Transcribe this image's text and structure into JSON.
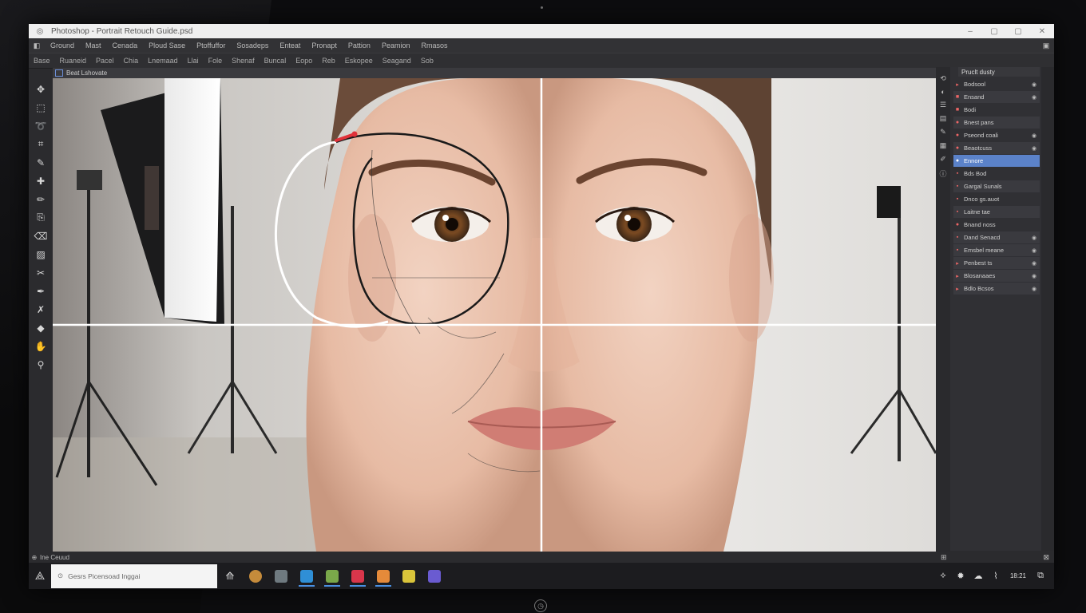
{
  "window": {
    "title": "Photoshop - Portrait Retouch Guide.psd",
    "controls": [
      "–",
      "▢",
      "✕"
    ],
    "close_glyph": "✕"
  },
  "menu": [
    "Ground",
    "Mast",
    "Cenada",
    "Ploud Sase",
    "Ptoffuffor",
    "Sosadeps",
    "Enteat",
    "Pronapt",
    "Pattion",
    "Peamion",
    "Rmasos"
  ],
  "options": [
    "Base",
    "Ruaneid",
    "Pacel",
    "Chia",
    "Lnemaad",
    "Llai",
    "Fole",
    "Shenaf",
    "Buncal",
    "Eopo",
    "Reb",
    "Eskopee",
    "Seagand",
    "Sob"
  ],
  "document_tab": {
    "label": "Beat Lshovate"
  },
  "tools": [
    {
      "name": "move-tool-icon",
      "glyph": "✥"
    },
    {
      "name": "marquee-tool-icon",
      "glyph": "⬚"
    },
    {
      "name": "lasso-tool-icon",
      "glyph": "➰"
    },
    {
      "name": "crop-tool-icon",
      "glyph": "⌗"
    },
    {
      "name": "eyedropper-tool-icon",
      "glyph": "✎"
    },
    {
      "name": "healing-tool-icon",
      "glyph": "✚"
    },
    {
      "name": "brush-tool-icon",
      "glyph": "✏"
    },
    {
      "name": "clone-tool-icon",
      "glyph": "⎘"
    },
    {
      "name": "eraser-tool-icon",
      "glyph": "⌫"
    },
    {
      "name": "gradient-tool-icon",
      "glyph": "▨"
    },
    {
      "name": "dodge-tool-icon",
      "glyph": "✂"
    },
    {
      "name": "pen-tool-icon",
      "glyph": "✒"
    },
    {
      "name": "text-tool-icon",
      "glyph": "✗"
    },
    {
      "name": "shape-tool-icon",
      "glyph": "◆"
    },
    {
      "name": "hand-tool-icon",
      "glyph": "✋"
    },
    {
      "name": "zoom-tool-icon",
      "glyph": "⚲"
    }
  ],
  "layers_panel": {
    "header": "Pruclt dusty",
    "group": "Bodsool",
    "layers": [
      {
        "label": "Ensand",
        "selected": false
      },
      {
        "label": "Bodi",
        "selected": false
      },
      {
        "label": "Bnest pans",
        "selected": false
      },
      {
        "label": "Pseond coali",
        "selected": false
      },
      {
        "label": "Beaotcuss",
        "selected": false
      },
      {
        "label": "Ennore",
        "selected": true
      },
      {
        "label": "Bds Bod",
        "selected": false
      },
      {
        "label": "Gargal Sunals",
        "selected": false
      },
      {
        "label": "Dnco gs.auot",
        "selected": false
      },
      {
        "label": "Laitne tae",
        "selected": false
      },
      {
        "label": "Bnand noss",
        "selected": false
      },
      {
        "label": "Dand Senacd",
        "selected": false
      },
      {
        "label": "Emsbel meane",
        "selected": false
      },
      {
        "label": "Penbest ts",
        "selected": false
      },
      {
        "label": "Blosanaaes",
        "selected": false
      },
      {
        "label": "Bdlo Bcsos",
        "selected": false
      }
    ]
  },
  "status": {
    "label": "Ine Ceuud"
  },
  "taskbar": {
    "search_placeholder": "Gesrs  Picensoad Inggai",
    "clock": "18:21"
  },
  "colors": {
    "accent_blue": "#5b82c9",
    "guide_red": "#e0323a"
  }
}
